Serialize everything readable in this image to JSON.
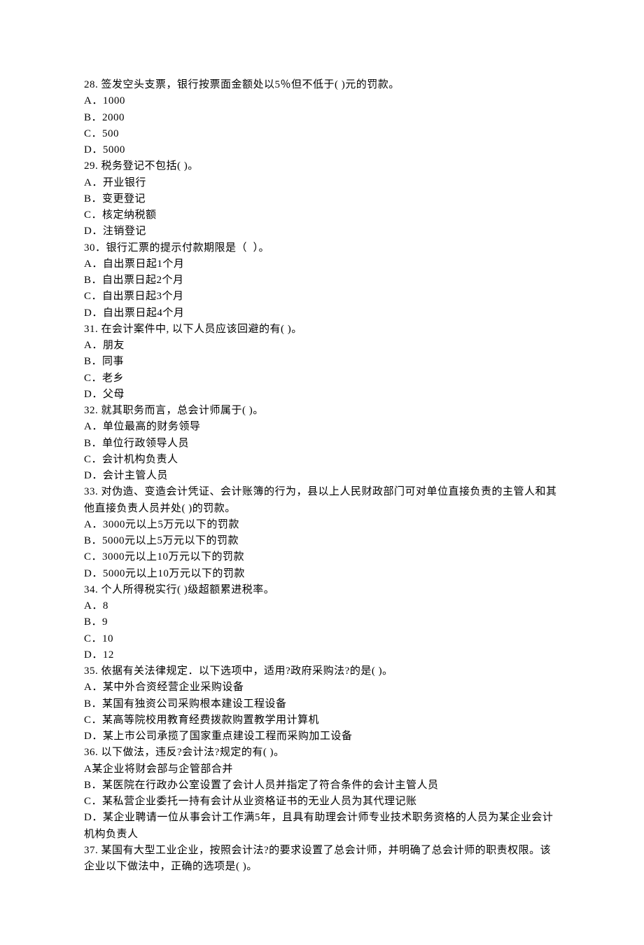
{
  "questions": [
    {
      "stem": "28. 签发空头支票，银行按票面金额处以5％但不低于( )元的罚款。",
      "options": [
        "A．1000",
        "B．2000",
        "C．500",
        "D．5000"
      ]
    },
    {
      "stem": "29. 税务登记不包括( )。",
      "options": [
        "A．开业银行",
        "B．变更登记",
        "C．核定纳税额",
        "D．注销登记"
      ]
    },
    {
      "stem": "30．银行汇票的提示付款期限是（  ）。",
      "options": [
        "A．自出票日起1个月",
        "B．自出票日起2个月",
        "C．自出票日起3个月",
        "D．自出票日起4个月"
      ]
    },
    {
      "stem": "31. 在会计案件中, 以下人员应该回避的有( )。",
      "options": [
        "A．朋友",
        "B．同事",
        "C．老乡",
        "D．父母"
      ]
    },
    {
      "stem": "32. 就其职务而言，总会计师属于( )。",
      "options": [
        "A．单位最高的财务领导",
        "B．单位行政领导人员",
        "C．会计机构负责人",
        "D．会计主管人员"
      ]
    },
    {
      "stem": "33. 对伪造、变造会计凭证、会计账簿的行为，县以上人民财政部门可对单位直接负责的主管人和其他直接负责人员并处( )的罚款。",
      "options": [
        "A．3000元以上5万元以下的罚款",
        "B．5000元以上5万元以下的罚款",
        "C．3000元以上10万元以下的罚款",
        "D．5000元以上10万元以下的罚款"
      ]
    },
    {
      "stem": "34. 个人所得税实行( )级超额累进税率。",
      "options": [
        "A．8",
        "B．9",
        "C．10",
        "D．12"
      ]
    },
    {
      "stem": "35. 依据有关法律规定．以下选项中，适用?政府采购法?的是( )。",
      "options": [
        "A．某中外合资经营企业采购设备",
        "B．某国有独资公司采购根本建设工程设备",
        "C．某高等院校用教育经费拨款购置教学用计算机",
        "D．某上市公司承揽了国家重点建设工程而采购加工设备"
      ]
    },
    {
      "stem": "36. 以下做法，违反?会计法?规定的有( )。",
      "options": [
        "A某企业将财会部与企管部合并",
        "B．某医院在行政办公室设置了会计人员并指定了符合条件的会计主管人员",
        "C．某私营企业委托一持有会计从业资格证书的无业人员为其代理记账",
        "D．某企业聘请一位从事会计工作满5年，且具有助理会计师专业技术职务资格的人员为某企业会计机构负责人"
      ]
    },
    {
      "stem": "37. 某国有大型工业企业，按照会计法?的要求设置了总会计师，并明确了总会计师的职责权限。该企业以下做法中，正确的选项是( )。",
      "options": []
    }
  ]
}
